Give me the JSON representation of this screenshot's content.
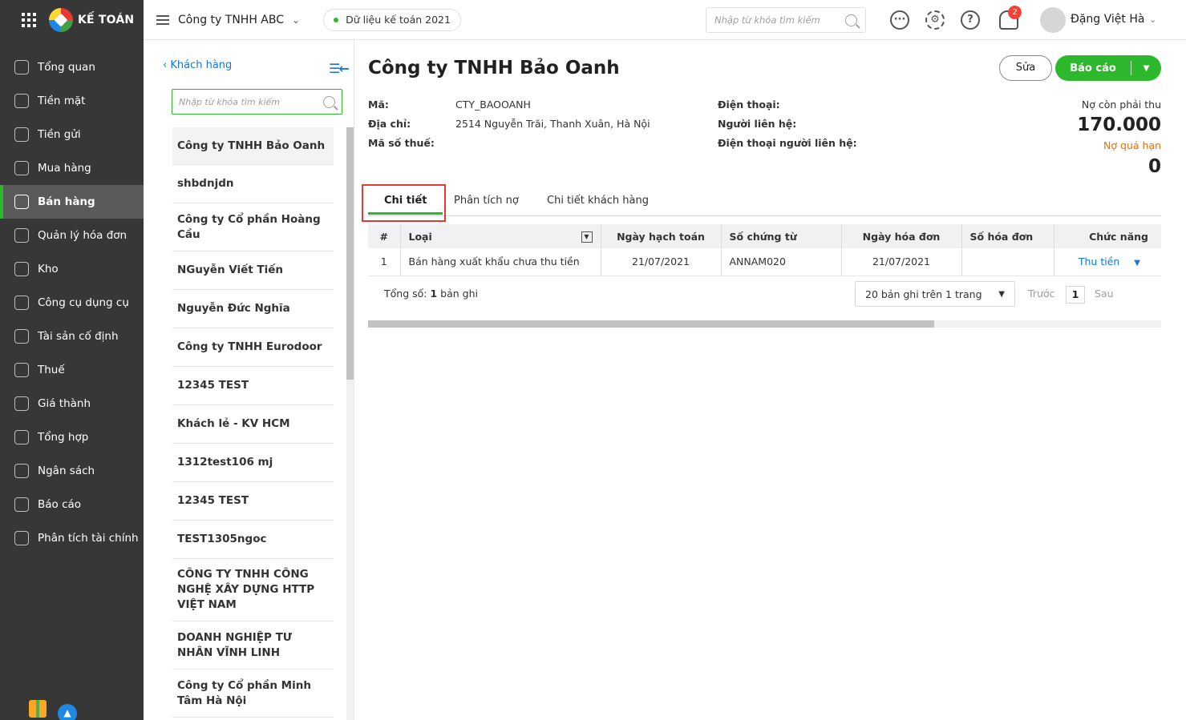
{
  "app": {
    "logo_text": "KẾ TOÁN"
  },
  "nav": {
    "items": [
      {
        "label": "Tổng quan",
        "icon": "dashboard-icon"
      },
      {
        "label": "Tiền mặt",
        "icon": "cash-icon"
      },
      {
        "label": "Tiền gửi",
        "icon": "bank-icon"
      },
      {
        "label": "Mua hàng",
        "icon": "shopping-bag-icon"
      },
      {
        "label": "Bán hàng",
        "icon": "cart-icon",
        "active": true
      },
      {
        "label": "Quản lý hóa đơn",
        "icon": "invoice-icon"
      },
      {
        "label": "Kho",
        "icon": "warehouse-icon"
      },
      {
        "label": "Công cụ dụng cụ",
        "icon": "tools-icon"
      },
      {
        "label": "Tài sản cố định",
        "icon": "asset-icon"
      },
      {
        "label": "Thuế",
        "icon": "tax-icon"
      },
      {
        "label": "Giá thành",
        "icon": "price-tag-icon"
      },
      {
        "label": "Tổng hợp",
        "icon": "summary-icon"
      },
      {
        "label": "Ngân sách",
        "icon": "budget-icon"
      },
      {
        "label": "Báo cáo",
        "icon": "report-chart-icon"
      },
      {
        "label": "Phân tích tài chính",
        "icon": "analysis-icon"
      }
    ]
  },
  "topbar": {
    "company": "Công ty TNHH ABC",
    "year_data": "Dữ liệu kế toán 2021",
    "search_placeholder": "Nhập từ khóa tìm kiếm",
    "notification_count": "2",
    "user_name": "Đặng Việt Hà"
  },
  "list": {
    "back_label": "Khách hàng",
    "search_placeholder": "Nhập từ khóa tìm kiếm",
    "items": [
      "Công ty TNHH Bảo Oanh",
      "shbdnjdn",
      "Công ty Cổ phần Hoàng Cầu",
      "NGuyễn Viết Tiến",
      "Nguyễn Đức Nghĩa",
      "Công ty TNHH Eurodoor",
      "12345 TEST",
      "Khách lẻ - KV HCM",
      "1312test106 mj",
      "12345 TEST",
      "TEST1305ngoc",
      "CÔNG TY TNHH CÔNG NGHỆ XÂY DỰNG HTTP VIỆT NAM",
      "DOANH NGHIỆP TƯ NHÂN VĨNH LINH",
      "Công ty Cổ phần Minh Tâm Hà Nội"
    ]
  },
  "detail": {
    "title": "Công ty TNHH Bảo Oanh",
    "edit_label": "Sửa",
    "report_label": "Báo cáo",
    "code_label": "Mã:",
    "code_value": "CTY_BAOOANH",
    "address_label": "Địa chỉ:",
    "address_value": "2514 Nguyễn Trãi, Thanh Xuân, Hà Nội",
    "tax_label": "Mã số thuế:",
    "phone_label": "Điện thoại:",
    "contact_label": "Người liên hệ:",
    "contact_phone_label": "Điện thoại người liên hệ:",
    "debt_label": "Nợ còn phải thu",
    "debt_value": "170.000",
    "overdue_label": "Nợ quá hạn",
    "overdue_value": "0"
  },
  "tabs": [
    "Chi tiết",
    "Phân tích nợ",
    "Chi tiết khách hàng"
  ],
  "table": {
    "headers": [
      "#",
      "Loại",
      "Ngày hạch toán",
      "Số chứng từ",
      "Ngày hóa đơn",
      "Số hóa đơn",
      "Chức năng"
    ],
    "rows": [
      {
        "no": "1",
        "type": "Bán hàng xuất khẩu chưa thu tiền",
        "post_date": "21/07/2021",
        "voucher_no": "ANNAM020",
        "invoice_date": "21/07/2021",
        "invoice_no": "",
        "action": "Thu tiền"
      }
    ]
  },
  "footer": {
    "total_label": "Tổng số:",
    "total_count": "1",
    "total_unit": "bản ghi",
    "page_size": "20 bản ghi trên 1 trang",
    "prev_label": "Trước",
    "page": "1",
    "next_label": "Sau"
  }
}
